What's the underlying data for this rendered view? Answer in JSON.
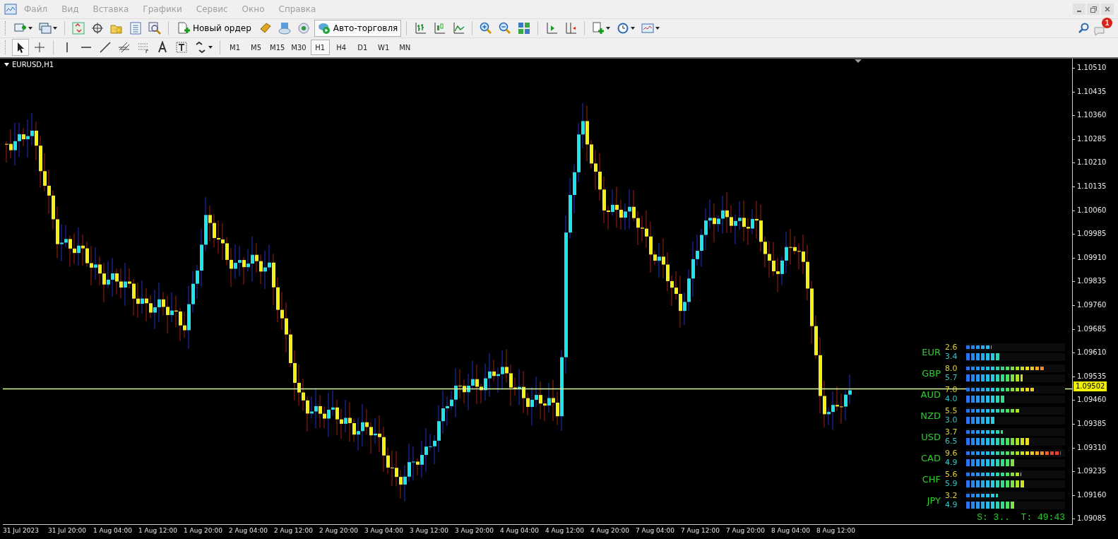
{
  "menu": [
    "Файл",
    "Вид",
    "Вставка",
    "Графики",
    "Сервис",
    "Окно",
    "Справка"
  ],
  "toolbar": {
    "new_order": "Новый ордер",
    "auto_trading": {
      "label": "Авто-торговля",
      "on": true
    },
    "notifications": "1"
  },
  "timeframes": [
    {
      "label": "M1",
      "selected": false
    },
    {
      "label": "M5",
      "selected": false
    },
    {
      "label": "M15",
      "selected": false
    },
    {
      "label": "M30",
      "selected": false
    },
    {
      "label": "H1",
      "selected": true
    },
    {
      "label": "H4",
      "selected": false
    },
    {
      "label": "D1",
      "selected": false
    },
    {
      "label": "W1",
      "selected": false
    },
    {
      "label": "MN",
      "selected": false
    }
  ],
  "chart": {
    "title": "EURUSD,H1",
    "current_price": "1.09502",
    "price_axis": [
      "1.10510",
      "1.10435",
      "1.10360",
      "1.10285",
      "1.10210",
      "1.10135",
      "1.10060",
      "1.09985",
      "1.09910",
      "1.09835",
      "1.09760",
      "1.09685",
      "1.09610",
      "1.09535",
      "1.09460",
      "1.09385",
      "1.09310",
      "1.09235",
      "1.09160",
      "1.09085"
    ],
    "time_axis": [
      "31 Jul 2023",
      "31 Jul 20:00",
      "1 Aug 04:00",
      "1 Aug 12:00",
      "1 Aug 20:00",
      "2 Aug 04:00",
      "2 Aug 12:00",
      "2 Aug 20:00",
      "3 Aug 04:00",
      "3 Aug 12:00",
      "3 Aug 20:00",
      "4 Aug 04:00",
      "4 Aug 12:00",
      "4 Aug 20:00",
      "7 Aug 04:00",
      "7 Aug 12:00",
      "7 Aug 20:00",
      "8 Aug 04:00",
      "8 Aug 12:00"
    ]
  },
  "strength": {
    "rows": [
      {
        "currency": "EUR",
        "meters": [
          {
            "reading": "2.6",
            "level": 0.26
          },
          {
            "reading": "3.4",
            "level": 0.34
          }
        ]
      },
      {
        "currency": "GBP",
        "meters": [
          {
            "reading": "8.0",
            "level": 0.8
          },
          {
            "reading": "5.7",
            "level": 0.57
          }
        ]
      },
      {
        "currency": "AUD",
        "meters": [
          {
            "reading": "7.0",
            "level": 0.7
          },
          {
            "reading": "4.0",
            "level": 0.4
          }
        ]
      },
      {
        "currency": "NZD",
        "meters": [
          {
            "reading": "5.5",
            "level": 0.55
          },
          {
            "reading": "3.0",
            "level": 0.3
          }
        ]
      },
      {
        "currency": "USD",
        "meters": [
          {
            "reading": "3.7",
            "level": 0.37
          },
          {
            "reading": "6.5",
            "level": 0.65
          }
        ]
      },
      {
        "currency": "CAD",
        "meters": [
          {
            "reading": "9.6",
            "level": 0.96
          },
          {
            "reading": "4.9",
            "level": 0.49
          }
        ]
      },
      {
        "currency": "CHF",
        "meters": [
          {
            "reading": "5.6",
            "level": 0.56
          },
          {
            "reading": "5.9",
            "level": 0.59
          }
        ]
      },
      {
        "currency": "JPY",
        "meters": [
          {
            "reading": "3.2",
            "level": 0.32
          },
          {
            "reading": "4.9",
            "level": 0.49
          }
        ]
      }
    ],
    "status": "S: 3..  T: 49:43"
  }
}
